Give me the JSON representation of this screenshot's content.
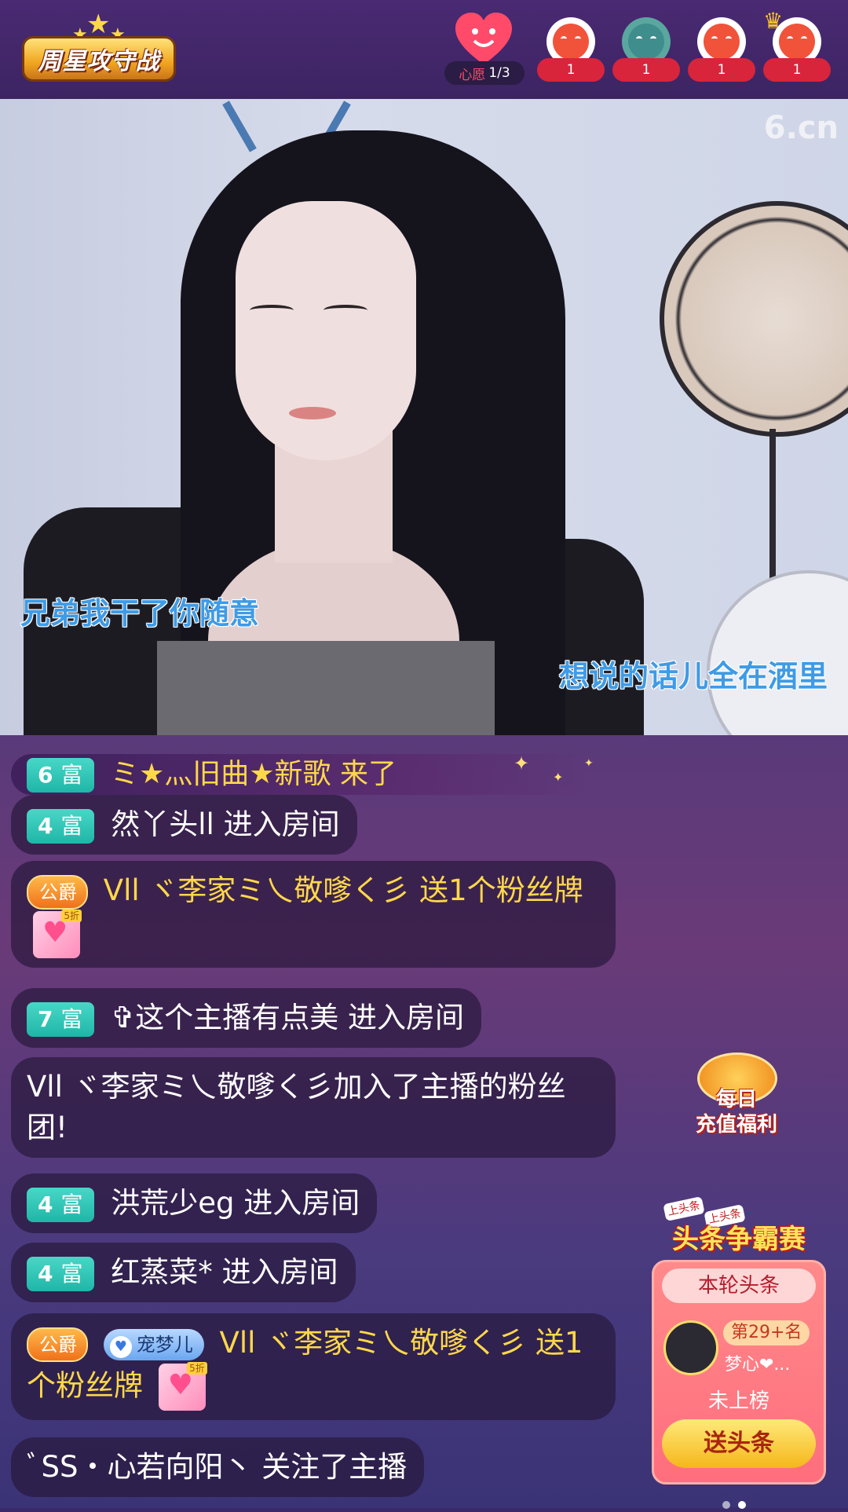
{
  "header": {
    "logo_text": "周星攻守战",
    "wish": {
      "label": "心愿",
      "progress": "1/3"
    },
    "viewers": [
      {
        "count": "1",
        "style": "red",
        "crown": false
      },
      {
        "count": "1",
        "style": "teal",
        "crown": false
      },
      {
        "count": "1",
        "style": "red",
        "crown": false
      },
      {
        "count": "1",
        "style": "red",
        "crown": true
      }
    ]
  },
  "video": {
    "watermark": "6.cn",
    "lyric_left": "兄弟我干了你随意",
    "lyric_right": "想说的话儿全在酒里"
  },
  "chat": {
    "banner": {
      "rich_level": "6",
      "rich_label": "富",
      "text": "ミ★灬旧曲★新歌 来了"
    },
    "messages": [
      {
        "rich_level": "4",
        "rich_label": "富",
        "text": "然丫头ll 进入房间"
      },
      {
        "duke": "公爵",
        "user": "Vll ヾ李家ミ乀敬嗲く彡",
        "action": "送1个粉丝牌",
        "gift_tag": "5折"
      },
      {
        "rich_level": "7",
        "rich_label": "富",
        "text": "✞这个主播有点美 进入房间"
      },
      {
        "text": "Vll ヾ李家ミ乀敬嗲く彡加入了主播的粉丝团!"
      },
      {
        "rich_level": "4",
        "rich_label": "富",
        "text": "洪荒少eg 进入房间"
      },
      {
        "rich_level": "4",
        "rich_label": "富",
        "text": "红蒸菜* 进入房间"
      },
      {
        "duke": "公爵",
        "fan_badge": "宠梦儿",
        "user": "Vll ヾ李家ミ乀敬嗲く彡",
        "action": "送1个粉丝牌",
        "gift_tag": "5折"
      },
      {
        "text": "ﾞSS・心若向阳丶 关注了主播"
      }
    ]
  },
  "promo": {
    "daily": {
      "line1": "每日",
      "line2": "充值福利"
    },
    "headline": {
      "tag1": "上头条",
      "tag2": "上头条",
      "title": "头条争霸赛",
      "round_label": "本轮头条",
      "rank": "第29+名",
      "name": "梦心❤...",
      "status": "未上榜",
      "button": "送头条"
    }
  },
  "colors": {
    "accent_gold": "#ffd84a",
    "rich_badge": "#1fb6a7",
    "headline_red": "#ff6e7e"
  },
  "icons": [
    "wish-heart-icon",
    "viewer-avatar-icon",
    "crown-icon",
    "fan-heart-icon",
    "gift-heart-icon",
    "coin-icon"
  ]
}
